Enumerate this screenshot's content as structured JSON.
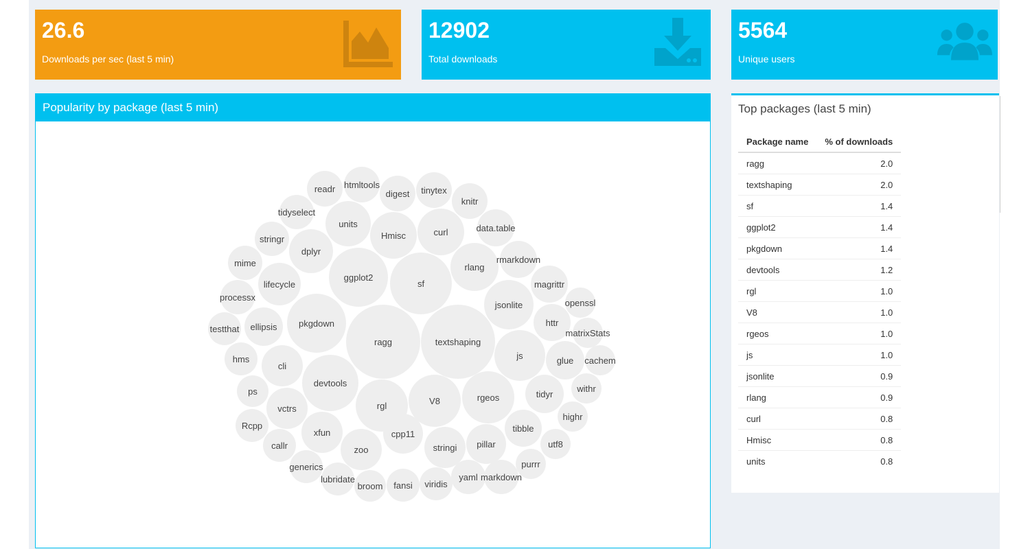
{
  "value_boxes": [
    {
      "value": "26.6",
      "subtitle": "Downloads per sec (last 5 min)",
      "color": "#f39c12",
      "icon": "area-chart-icon"
    },
    {
      "value": "12902",
      "subtitle": "Total downloads",
      "color": "#00c0ef",
      "icon": "download-icon"
    },
    {
      "value": "5564",
      "subtitle": "Unique users",
      "color": "#00c0ef",
      "icon": "users-icon"
    }
  ],
  "bubble_panel": {
    "title": "Popularity by package (last 5 min)"
  },
  "table_panel": {
    "title": "Top packages (last 5 min)",
    "columns": [
      "Package name",
      "% of downloads"
    ],
    "rows": [
      [
        "ragg",
        "2.0"
      ],
      [
        "textshaping",
        "2.0"
      ],
      [
        "sf",
        "1.4"
      ],
      [
        "ggplot2",
        "1.4"
      ],
      [
        "pkgdown",
        "1.4"
      ],
      [
        "devtools",
        "1.2"
      ],
      [
        "rgl",
        "1.0"
      ],
      [
        "V8",
        "1.0"
      ],
      [
        "rgeos",
        "1.0"
      ],
      [
        "js",
        "1.0"
      ],
      [
        "jsonlite",
        "0.9"
      ],
      [
        "rlang",
        "0.9"
      ],
      [
        "curl",
        "0.8"
      ],
      [
        "Hmisc",
        "0.8"
      ],
      [
        "units",
        "0.8"
      ]
    ]
  },
  "chart_data": {
    "type": "bubble",
    "title": "Popularity by package (last 5 min)",
    "nodes": [
      "ragg",
      "textshaping",
      "sf",
      "ggplot2",
      "pkgdown",
      "devtools",
      "rgl",
      "V8",
      "rgeos",
      "js",
      "jsonlite",
      "rlang",
      "curl",
      "Hmisc",
      "units",
      "dplyr",
      "lifecycle",
      "cli",
      "ellipsis",
      "vctrs",
      "xfun",
      "zoo",
      "cpp11",
      "stringi",
      "pillar",
      "tidyr",
      "glue",
      "tibble",
      "httr",
      "rmarkdown",
      "magrittr",
      "knitr",
      "digest",
      "tinytex",
      "htmltools",
      "readr",
      "tidyselect",
      "stringr",
      "mime",
      "processx",
      "testthat",
      "hms",
      "ps",
      "Rcpp",
      "callr",
      "generics",
      "lubridate",
      "broom",
      "fansi",
      "viridis",
      "yaml",
      "markdown",
      "purrr",
      "utf8",
      "highr",
      "withr",
      "cachem",
      "matrixStats",
      "openssl",
      "data.table"
    ]
  }
}
